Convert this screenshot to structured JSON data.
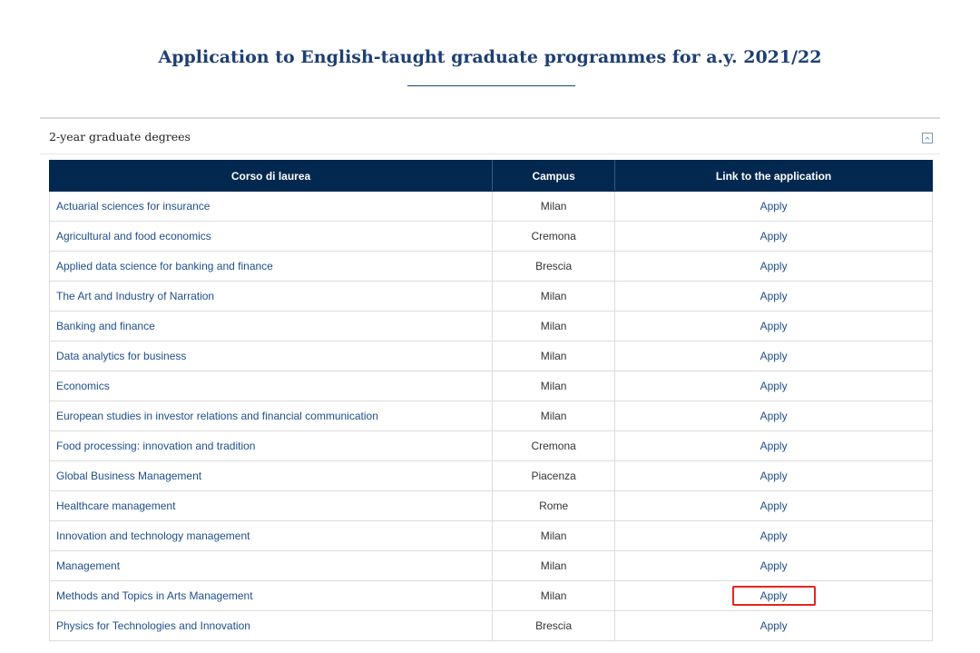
{
  "page": {
    "title": "Application to English-taught graduate programmes for a.y. 2021/22"
  },
  "accordion": {
    "title": "2-year graduate degrees",
    "toggle_icon": "chevron-up-icon"
  },
  "table": {
    "headers": [
      "Corso di laurea",
      "Campus",
      "Link to the application"
    ],
    "rows": [
      {
        "course": "Actuarial sciences for insurance",
        "campus": "Milan",
        "link": "Apply",
        "highlighted": false
      },
      {
        "course": "Agricultural and food economics",
        "campus": "Cremona",
        "link": "Apply",
        "highlighted": false
      },
      {
        "course": "Applied data science for banking and finance",
        "campus": "Brescia",
        "link": "Apply",
        "highlighted": false
      },
      {
        "course": "The Art and Industry of Narration",
        "campus": "Milan",
        "link": "Apply",
        "highlighted": false
      },
      {
        "course": "Banking and finance",
        "campus": "Milan",
        "link": "Apply",
        "highlighted": false
      },
      {
        "course": "Data analytics for business",
        "campus": "Milan",
        "link": "Apply",
        "highlighted": false
      },
      {
        "course": "Economics",
        "campus": "Milan",
        "link": "Apply",
        "highlighted": false
      },
      {
        "course": "European studies in investor relations and financial communication",
        "campus": "Milan",
        "link": "Apply",
        "highlighted": false
      },
      {
        "course": "Food processing: innovation and tradition",
        "campus": "Cremona",
        "link": "Apply",
        "highlighted": false
      },
      {
        "course": "Global Business Management",
        "campus": "Piacenza",
        "link": "Apply",
        "highlighted": false
      },
      {
        "course": "Healthcare management",
        "campus": "Rome",
        "link": "Apply",
        "highlighted": false
      },
      {
        "course": "Innovation and technology management",
        "campus": "Milan",
        "link": "Apply",
        "highlighted": false
      },
      {
        "course": "Management",
        "campus": "Milan",
        "link": "Apply",
        "highlighted": false
      },
      {
        "course": "Methods and Topics in Arts Management",
        "campus": "Milan",
        "link": "Apply",
        "highlighted": true
      },
      {
        "course": "Physics for Technologies and Innovation",
        "campus": "Brescia",
        "link": "Apply",
        "highlighted": false
      }
    ]
  },
  "colors": {
    "title": "#1f3f73",
    "header_bg": "#03284f",
    "link": "#1f4e8c",
    "highlight_border": "#e8241b"
  }
}
